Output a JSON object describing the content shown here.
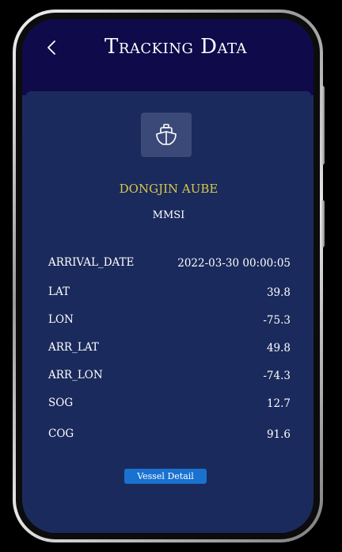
{
  "header": {
    "title": "Tracking Data",
    "back_icon": "chevron-left-icon"
  },
  "vessel": {
    "icon": "ship-icon",
    "name": "DONGJIN AUBE",
    "id_label": "MMSI"
  },
  "fields": [
    {
      "label": "ARRIVAL_DATE",
      "value": "2022-03-30 00:00:05"
    },
    {
      "label": "LAT",
      "value": "39.8"
    },
    {
      "label": "LON",
      "value": "-75.3"
    },
    {
      "label": "ARR_LAT",
      "value": "49.8"
    },
    {
      "label": "ARR_LON",
      "value": "-74.3"
    },
    {
      "label": "SOG",
      "value": "12.7"
    },
    {
      "label": "COG",
      "value": "91.6"
    }
  ],
  "actions": {
    "detail_label": "Vessel Detail"
  },
  "colors": {
    "header_bg": "#0f0a4a",
    "card_bg": "#1b2a5c",
    "vessel_name": "#d6c94a",
    "button_bg": "#1a72d0"
  }
}
